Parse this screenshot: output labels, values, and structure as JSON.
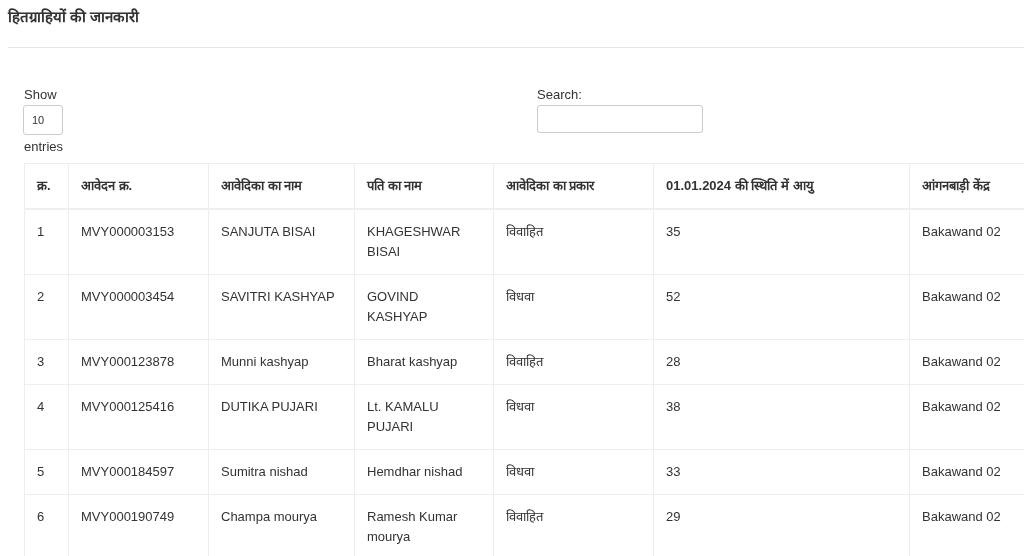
{
  "title": "हितग्राहियों की जानकारी",
  "length_control": {
    "label_before": "Show",
    "value": "10",
    "label_after": "entries"
  },
  "search": {
    "label": "Search:"
  },
  "table": {
    "columns": [
      "क्र.",
      "आवेदन क्र.",
      "आवेदिका का नाम",
      "पति का नाम",
      "आवेदिका का प्रकार",
      "01.01.2024 की स्थिति में आयु",
      "आंगनबाड़ी केंद्र"
    ],
    "rows": [
      [
        "1",
        "MVY000003153",
        "SANJUTA BISAI",
        "KHAGESHWAR BISAI",
        "विवाहित",
        "35",
        "Bakawand 02"
      ],
      [
        "2",
        "MVY000003454",
        "SAVITRI KASHYAP",
        "GOVIND KASHYAP",
        "विधवा",
        "52",
        "Bakawand 02"
      ],
      [
        "3",
        "MVY000123878",
        "Munni kashyap",
        "Bharat kashyap",
        "विवाहित",
        "28",
        "Bakawand 02"
      ],
      [
        "4",
        "MVY000125416",
        "DUTIKA PUJARI",
        "Lt. KAMALU PUJARI",
        "विधवा",
        "38",
        "Bakawand 02"
      ],
      [
        "5",
        "MVY000184597",
        "Sumitra nishad",
        "Hemdhar nishad",
        "विधवा",
        "33",
        "Bakawand 02"
      ],
      [
        "6",
        "MVY000190749",
        "Champa mourya",
        "Ramesh Kumar mourya",
        "विवाहित",
        "29",
        "Bakawand 02"
      ]
    ]
  }
}
